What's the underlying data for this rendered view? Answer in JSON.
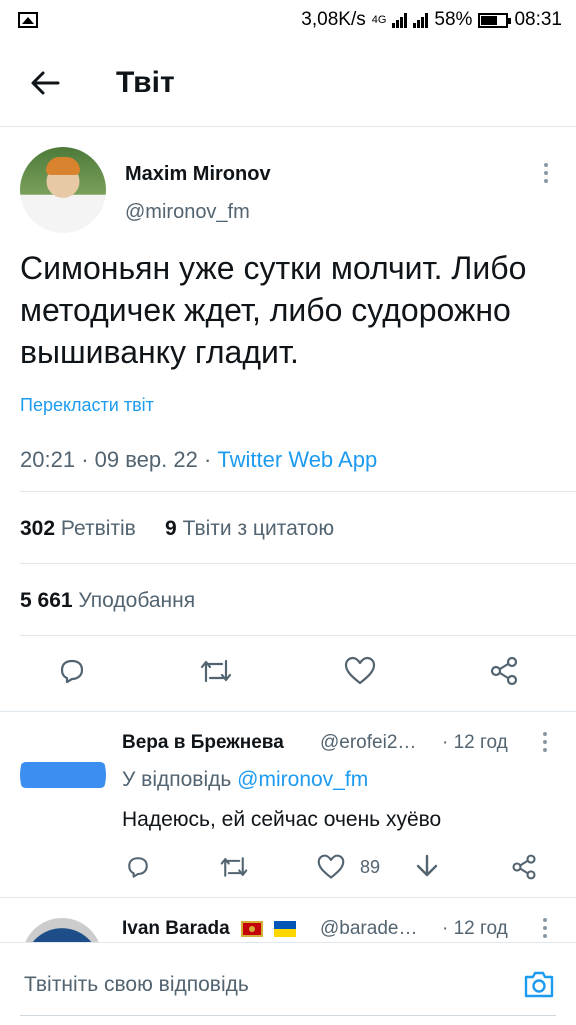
{
  "status_bar": {
    "speed": "3,08K/s",
    "network": "4G",
    "battery_percent": "58%",
    "battery_level": 0.58,
    "time": "08:31"
  },
  "header": {
    "title": "Твіт",
    "back_icon": "arrow-left-icon"
  },
  "tweet": {
    "author_name": "Maxim Mironov",
    "author_handle": "@mironov_fm",
    "text": "Симоньян уже сутки молчит. Либо методичек ждет, либо судорожно вышиванку гладит.",
    "translate_label": "Перекласти твіт",
    "time": "20:21",
    "date": "09 вер. 22",
    "separator": "·",
    "source": "Twitter Web App",
    "retweets_count": "302",
    "retweets_label": "Ретвітів",
    "quotes_count": "9",
    "quotes_label": "Твіти з цитатою",
    "likes_count": "5 661",
    "likes_label": "Уподобання",
    "actions": [
      "reply-icon",
      "retweet-icon",
      "like-icon",
      "share-icon"
    ]
  },
  "replies": [
    {
      "author_name": "Вера в Брежнева",
      "author_handle": "@erofei2…",
      "time": "· 12 год",
      "reply_to_label": "У відповідь",
      "reply_to_handle": "@mironov_fm",
      "text": "Надеюсь, ей сейчас очень хуёво",
      "like_count": "89"
    },
    {
      "author_name": "Ivan Barada",
      "author_handle": "@barade…",
      "time": "· 12 год"
    }
  ],
  "composer": {
    "placeholder": "Твітніть свою відповідь",
    "camera_icon": "camera-icon"
  },
  "colors": {
    "accent": "#1d9bf0",
    "text_primary": "#0f1419",
    "text_secondary": "#536471",
    "divider": "#e1e8ed"
  }
}
